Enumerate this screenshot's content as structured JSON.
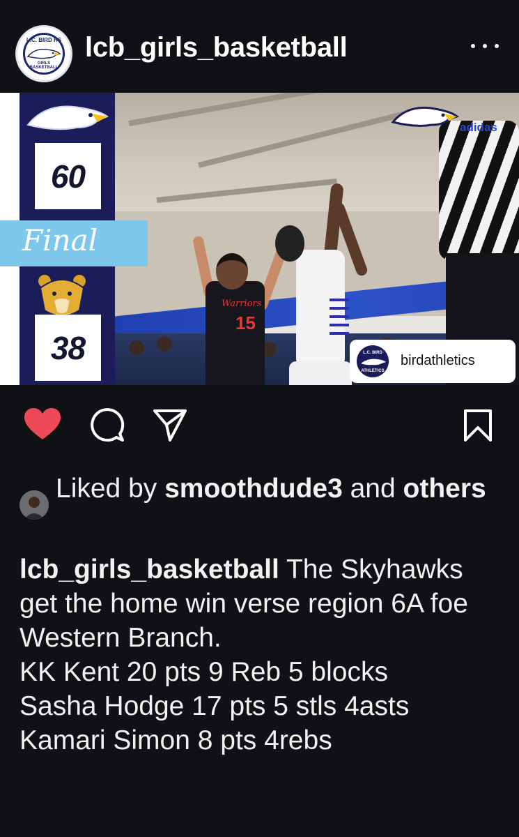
{
  "header": {
    "username": "lcb_girls_basketball",
    "avatar_text_top": "L.C. BIRD HS",
    "avatar_text_bottom": "GIRLS BASKETBALL"
  },
  "post_image": {
    "home_score": "60",
    "away_score": "38",
    "status_label": "Final",
    "brand_text": "adidas",
    "away_jersey_name": "Warriors",
    "away_jersey_number": "15",
    "tag_username": "birdathletics",
    "tag_logo_top": "L.C. BIRD",
    "tag_logo_bottom": "ATHLETICS",
    "colors": {
      "navy": "#1b1d5a",
      "final_banner": "#7ec7ec",
      "gym_blue": "#2c52c8"
    }
  },
  "actions": {
    "like_state": "liked",
    "like_color": "#ed4956",
    "icons": [
      "heart-icon",
      "comment-icon",
      "share-icon",
      "bookmark-icon"
    ]
  },
  "likes": {
    "prefix": "Liked by ",
    "user": "smoothdude3",
    "middle": " and ",
    "suffix": "others"
  },
  "caption": {
    "author": "lcb_girls_basketball",
    "text": "The Skyhawks get the home win verse region 6A foe Western Branch.",
    "lines": [
      "KK Kent 20 pts 9 Reb 5 blocks",
      "Sasha Hodge 17 pts 5 stls 4asts",
      "Kamari Simon 8 pts 4rebs"
    ]
  }
}
